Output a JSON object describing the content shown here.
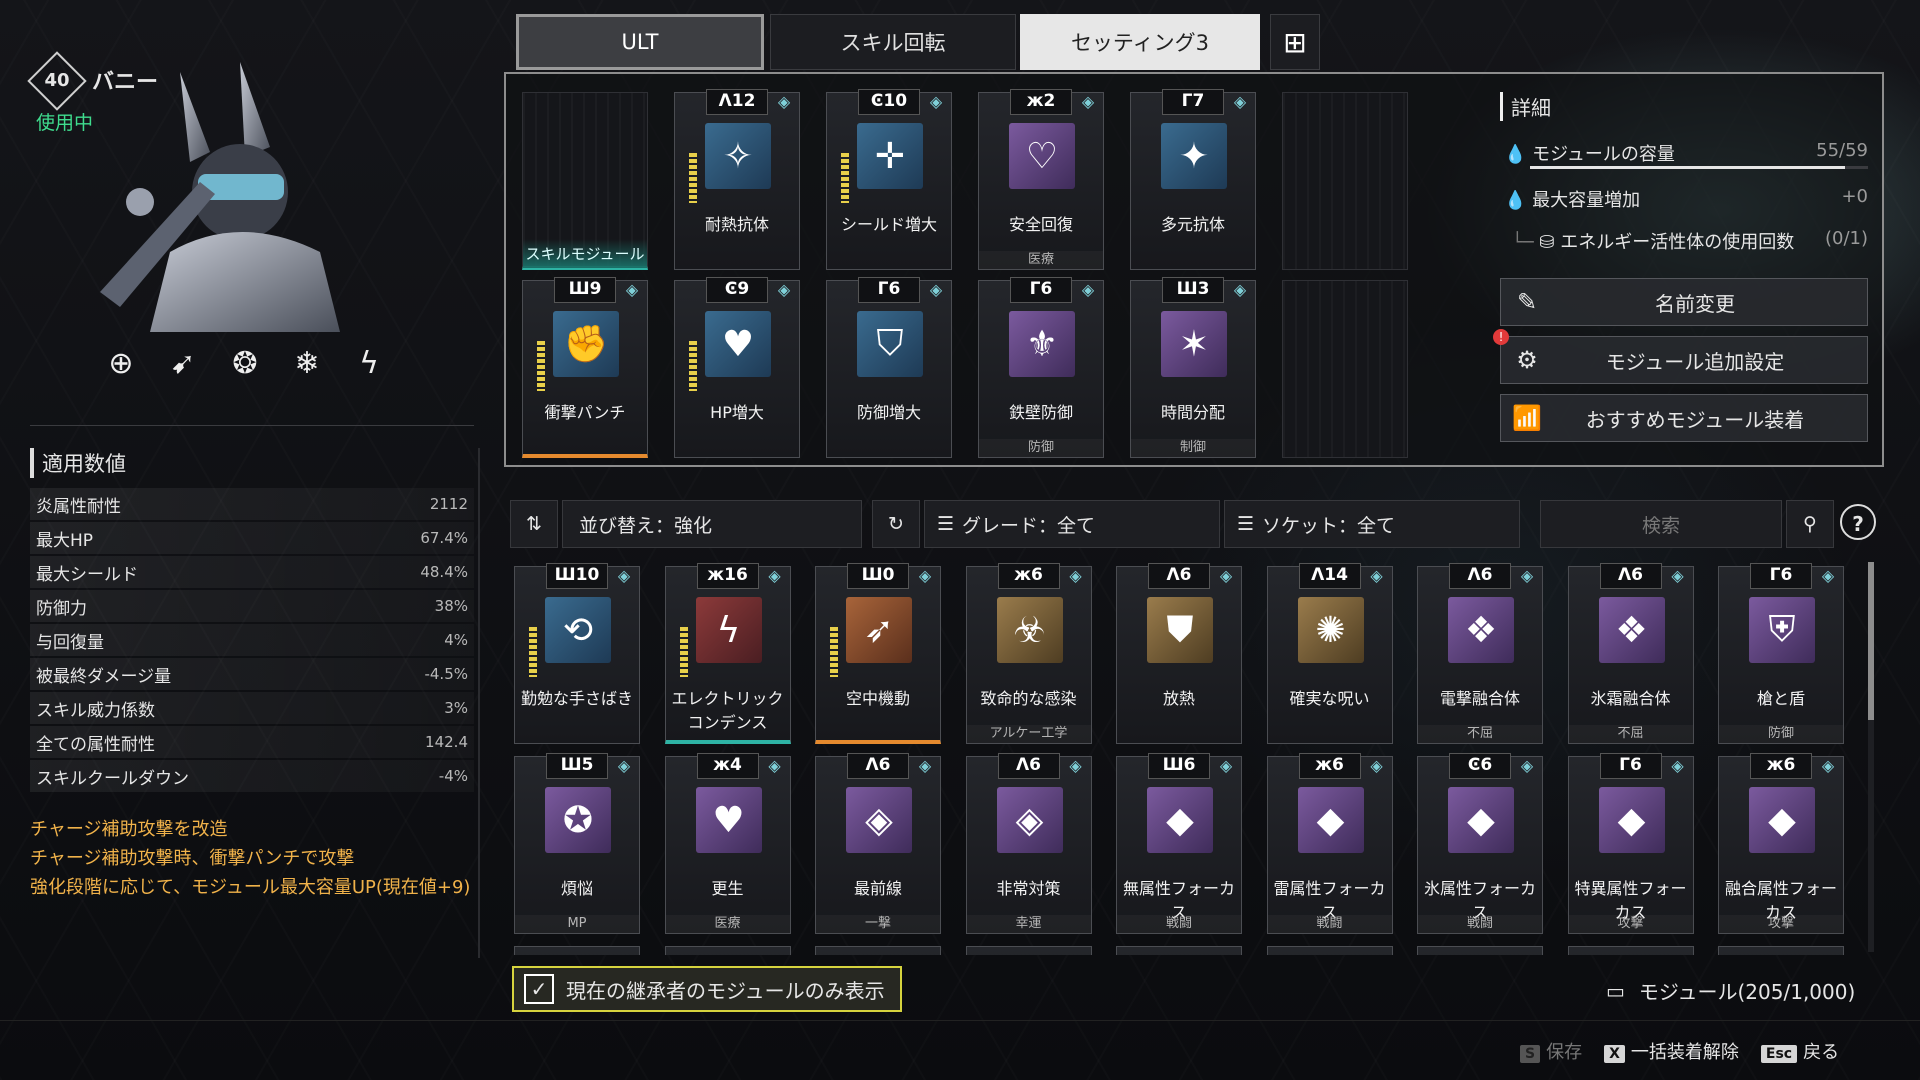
{
  "character": {
    "level": "40",
    "name": "バニー",
    "status": "使用中"
  },
  "traits": [
    "target-icon",
    "arrows-icon",
    "spiral-icon",
    "snowflake-icon",
    "lightning-icon"
  ],
  "stats": {
    "title": "適用数値",
    "rows": [
      {
        "label": "炎属性耐性",
        "value": "2112"
      },
      {
        "label": "最大HP",
        "value": "67.4%"
      },
      {
        "label": "最大シールド",
        "value": "48.4%"
      },
      {
        "label": "防御力",
        "value": "38%"
      },
      {
        "label": "与回復量",
        "value": "4%"
      },
      {
        "label": "被最終ダメージ量",
        "value": "-4.5%"
      },
      {
        "label": "スキル威力係数",
        "value": "3%"
      },
      {
        "label": "全ての属性耐性",
        "value": "142.4"
      },
      {
        "label": "スキルクールダウン",
        "value": "-4%"
      }
    ]
  },
  "description": [
    "チャージ補助攻撃を改造",
    "チャージ補助攻撃時、衝撃パンチで攻撃",
    "強化段階に応じて、モジュール最大容量UP(現在値+9)"
  ],
  "tabs": {
    "ult": "ULT",
    "rotation": "スキル回転",
    "setting": "セッティング3"
  },
  "equipped": {
    "empty_label": "スキルモジュール",
    "row1": [
      {
        "cap": "Λ12",
        "name": "耐熱抗体",
        "tag": "",
        "color": "blue",
        "icon": "✧"
      },
      {
        "cap": "Ͼ10",
        "name": "シールド増大",
        "tag": "",
        "color": "blue",
        "icon": "✛"
      },
      {
        "cap": "ж2",
        "name": "安全回復",
        "tag": "医療",
        "color": "purple",
        "icon": "♡"
      },
      {
        "cap": "Γ7",
        "name": "多元抗体",
        "tag": "",
        "color": "blue",
        "icon": "✦"
      }
    ],
    "row2": [
      {
        "cap": "Ш9",
        "name": "衝撃パンチ",
        "tag": "",
        "color": "blue",
        "icon": "✊"
      },
      {
        "cap": "Ͼ9",
        "name": "HP増大",
        "tag": "",
        "color": "blue",
        "icon": "♥"
      },
      {
        "cap": "Γ6",
        "name": "防御増大",
        "tag": "",
        "color": "blue",
        "icon": "⛉"
      },
      {
        "cap": "Γ6",
        "name": "鉄壁防御",
        "tag": "防御",
        "color": "purple",
        "icon": "⚜"
      },
      {
        "cap": "Ш3",
        "name": "時間分配",
        "tag": "制御",
        "color": "purple",
        "icon": "✶"
      }
    ]
  },
  "details": {
    "title": "詳細",
    "capacity_label": "モジュールの容量",
    "capacity_value": "55/59",
    "capacity_fraction": 0.932,
    "maxcap_label": "最大容量増加",
    "maxcap_value": "+0",
    "energy_label": "エネルギー活性体の使用回数",
    "energy_value": "(0/1)",
    "btn_rename": "名前変更",
    "btn_extra": "モジュール追加設定",
    "btn_recommend": "おすすめモジュール装着"
  },
  "filters": {
    "sort": "並び替え：強化",
    "grade": "グレード：全て",
    "socket": "ソケット：全て",
    "search_placeholder": "検索"
  },
  "inventory": {
    "row1": [
      {
        "cap": "Ш10",
        "name": "勤勉な手さばき",
        "tag": "",
        "color": "blue",
        "icon": "⟲"
      },
      {
        "cap": "ж16",
        "name": "エレクトリックコンデンス",
        "tag": "",
        "color": "red",
        "icon": "ϟ"
      },
      {
        "cap": "Ш0",
        "name": "空中機動",
        "tag": "",
        "color": "orange",
        "icon": "➶"
      },
      {
        "cap": "ж6",
        "name": "致命的な感染",
        "tag": "アルケー工学",
        "color": "gold",
        "icon": "☣"
      },
      {
        "cap": "Λ6",
        "name": "放熱",
        "tag": "",
        "color": "gold",
        "icon": "⛊"
      },
      {
        "cap": "Λ14",
        "name": "確実な呪い",
        "tag": "",
        "color": "gold",
        "icon": "✺"
      },
      {
        "cap": "Λ6",
        "name": "電撃融合体",
        "tag": "不屈",
        "color": "purple",
        "icon": "❖"
      },
      {
        "cap": "Λ6",
        "name": "氷霜融合体",
        "tag": "不屈",
        "color": "purple",
        "icon": "❖"
      },
      {
        "cap": "Γ6",
        "name": "槍と盾",
        "tag": "防御",
        "color": "purple",
        "icon": "⛨"
      }
    ],
    "row2": [
      {
        "cap": "Ш5",
        "name": "煩悩",
        "tag": "MP",
        "color": "purple",
        "icon": "✪"
      },
      {
        "cap": "ж4",
        "name": "更生",
        "tag": "医療",
        "color": "purple",
        "icon": "♥"
      },
      {
        "cap": "Λ6",
        "name": "最前線",
        "tag": "一撃",
        "color": "purple",
        "icon": "◈"
      },
      {
        "cap": "Λ6",
        "name": "非常対策",
        "tag": "幸運",
        "color": "purple",
        "icon": "◈"
      },
      {
        "cap": "Ш6",
        "name": "無属性フォーカス",
        "tag": "戦闘",
        "color": "purple",
        "icon": "◆"
      },
      {
        "cap": "ж6",
        "name": "雷属性フォーカス",
        "tag": "戦闘",
        "color": "purple",
        "icon": "◆"
      },
      {
        "cap": "Ͼ6",
        "name": "氷属性フォーカス",
        "tag": "戦闘",
        "color": "purple",
        "icon": "◆"
      },
      {
        "cap": "Γ6",
        "name": "特異属性フォーカス",
        "tag": "攻撃",
        "color": "purple",
        "icon": "◆"
      },
      {
        "cap": "ж6",
        "name": "融合属性フォーカス",
        "tag": "攻撃",
        "color": "purple",
        "icon": "◆"
      }
    ]
  },
  "checkbox_label": "現在の継承者のモジュールのみ表示",
  "module_count": "モジュール(205/1,000)",
  "footer": {
    "save_key": "S",
    "save": "保存",
    "unequip_key": "X",
    "unequip": "一括装着解除",
    "back_key": "Esc",
    "back": "戻る"
  }
}
